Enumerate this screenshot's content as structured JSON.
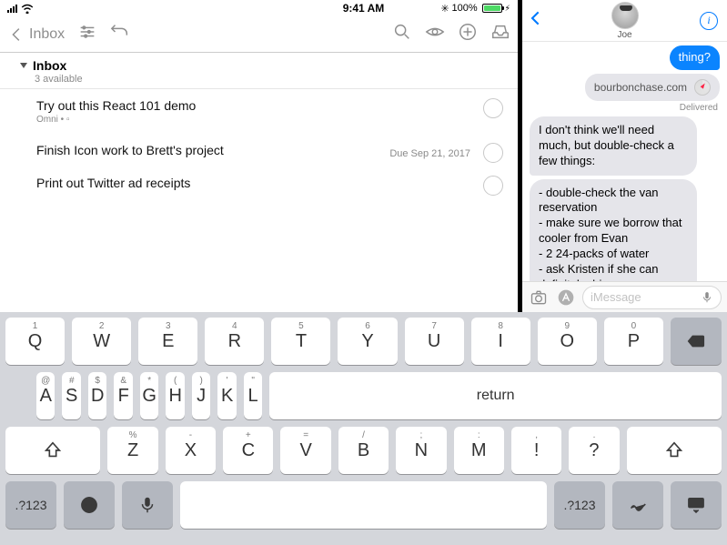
{
  "status": {
    "time": "9:41 AM",
    "battery": "100%",
    "bt_icon": "*",
    "charging": true
  },
  "leftApp": {
    "backLabel": "Inbox",
    "header": {
      "title": "Inbox",
      "subtitle": "3 available"
    },
    "items": [
      {
        "title": "Try out this React 101 demo",
        "meta": "Omni • ▫",
        "due": ""
      },
      {
        "title": "Finish Icon work to Brett's project",
        "meta": "",
        "due": "Due Sep 21, 2017"
      },
      {
        "title": "Print out Twitter ad receipts",
        "meta": "",
        "due": ""
      }
    ]
  },
  "messages": {
    "contactName": "Joe",
    "outgoingTail": "thing?",
    "link": "bourbonchase.com",
    "delivered": "Delivered",
    "incoming1": "I don't think we'll need much, but double-check a few things:",
    "incoming2": "- double-check the van reservation\n- make sure we borrow that cooler from Evan\n- 2 24-packs of water\n- ask Kristen if she can definitely drive\n- book airbnb",
    "placeholder": "iMessage"
  },
  "keyboard": {
    "row1": [
      {
        "m": "Q",
        "a": "1"
      },
      {
        "m": "W",
        "a": "2"
      },
      {
        "m": "E",
        "a": "3"
      },
      {
        "m": "R",
        "a": "4"
      },
      {
        "m": "T",
        "a": "5"
      },
      {
        "m": "Y",
        "a": "6"
      },
      {
        "m": "U",
        "a": "7"
      },
      {
        "m": "I",
        "a": "8"
      },
      {
        "m": "O",
        "a": "9"
      },
      {
        "m": "P",
        "a": "0"
      }
    ],
    "row2": [
      {
        "m": "A",
        "a": "@"
      },
      {
        "m": "S",
        "a": "#"
      },
      {
        "m": "D",
        "a": "$"
      },
      {
        "m": "F",
        "a": "&"
      },
      {
        "m": "G",
        "a": "*"
      },
      {
        "m": "H",
        "a": "("
      },
      {
        "m": "J",
        "a": ")"
      },
      {
        "m": "K",
        "a": "'"
      },
      {
        "m": "L",
        "a": "\""
      }
    ],
    "row3": [
      {
        "m": "Z",
        "a": "%"
      },
      {
        "m": "X",
        "a": "-"
      },
      {
        "m": "C",
        "a": "+"
      },
      {
        "m": "V",
        "a": "="
      },
      {
        "m": "B",
        "a": "/"
      },
      {
        "m": "N",
        "a": ";"
      },
      {
        "m": "M",
        "a": ":"
      },
      {
        "m": "!",
        "a": ","
      },
      {
        "m": "?",
        "a": "."
      }
    ],
    "returnLabel": "return",
    "numLabel": ".?123"
  }
}
